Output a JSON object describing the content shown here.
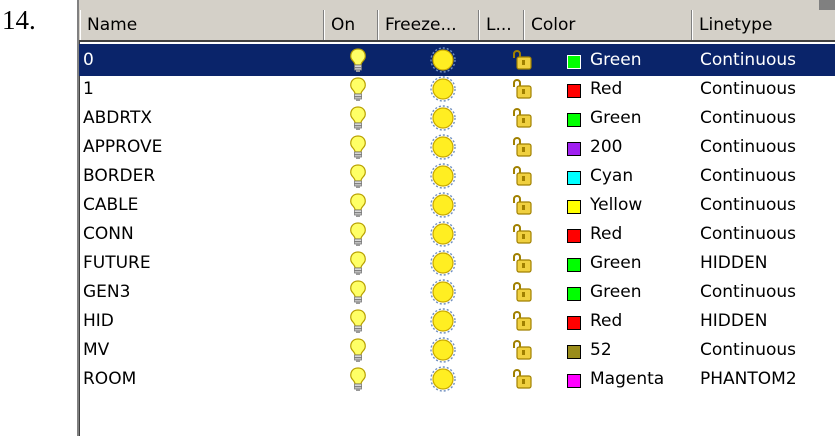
{
  "doc_number": "14.",
  "columns": {
    "name": "Name",
    "on": "On",
    "freeze": "Freeze...",
    "lock": "L...",
    "color": "Color",
    "linetype": "Linetype"
  },
  "selected_row": 0,
  "icons": {
    "on": "lightbulb-icon",
    "freeze": "sun-icon",
    "lock": "padlock-icon"
  },
  "rows": [
    {
      "name": "0",
      "color": "Green",
      "swatch": "#00ff00",
      "linetype": "Continuous"
    },
    {
      "name": "1",
      "color": "Red",
      "swatch": "#ff0000",
      "linetype": "Continuous"
    },
    {
      "name": "ABDRTX",
      "color": "Green",
      "swatch": "#00ff00",
      "linetype": "Continuous"
    },
    {
      "name": "APPROVE",
      "color": "200",
      "swatch": "#a020f0",
      "linetype": "Continuous"
    },
    {
      "name": "BORDER",
      "color": "Cyan",
      "swatch": "#00ffff",
      "linetype": "Continuous"
    },
    {
      "name": "CABLE",
      "color": "Yellow",
      "swatch": "#ffff00",
      "linetype": "Continuous"
    },
    {
      "name": "CONN",
      "color": "Red",
      "swatch": "#ff0000",
      "linetype": "Continuous"
    },
    {
      "name": "FUTURE",
      "color": "Green",
      "swatch": "#00ff00",
      "linetype": "HIDDEN"
    },
    {
      "name": "GEN3",
      "color": "Green",
      "swatch": "#00ff00",
      "linetype": "Continuous"
    },
    {
      "name": "HID",
      "color": "Red",
      "swatch": "#ff0000",
      "linetype": "HIDDEN"
    },
    {
      "name": "MV",
      "color": "52",
      "swatch": "#9a8c1a",
      "linetype": "Continuous"
    },
    {
      "name": "ROOM",
      "color": "Magenta",
      "swatch": "#ff00ff",
      "linetype": "PHANTOM2"
    }
  ]
}
